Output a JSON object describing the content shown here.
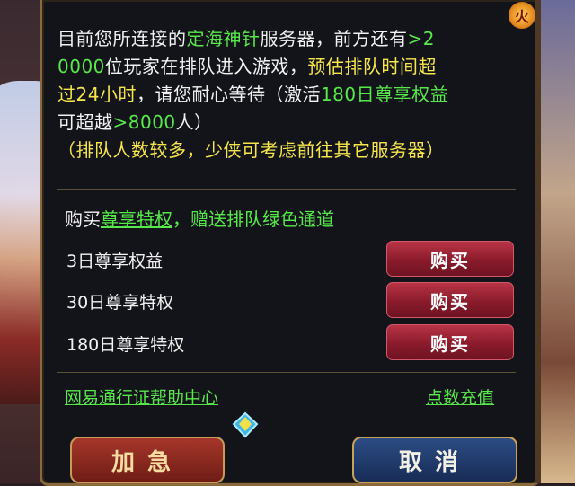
{
  "corner_icon": {
    "glyph": "火",
    "name": "fire-badge-icon"
  },
  "queue_message": {
    "line1_a": "目前您所连接的",
    "server_name": "定海神针",
    "line1_b": "服务器，前方还有",
    "ahead_count_a": ">2",
    "ahead_count_b": "0000",
    "line2_a": "位玩家在排队进入游戏，",
    "estimate_a": "预估排队时间超",
    "estimate_b": "过24小时",
    "line3_a": "，请您耐心等待（激活",
    "vip_days": "180日尊享权益",
    "line4_a": "可超越",
    "skip_count": ">8000",
    "line4_b": "人）",
    "hint": "（排队人数较多，少侠可考虑前往其它服务器）"
  },
  "purchase": {
    "title_a": "购买",
    "title_link": "尊享特权",
    "title_b": "，赠送排队绿色通道",
    "items": [
      {
        "label": "3日尊享权益",
        "button": "购买"
      },
      {
        "label": "30日尊享特权",
        "button": "购买"
      },
      {
        "label": "180日尊享特权",
        "button": "购买"
      }
    ]
  },
  "links": {
    "help_center": "网易通行证帮助中心",
    "recharge": "点数充值"
  },
  "actions": {
    "accelerate": "加急",
    "cancel": "取消"
  },
  "colors": {
    "highlight_green": "#57e84b",
    "highlight_yellow": "#f6e64b",
    "buy_button": "#a0283a",
    "accelerate_button": "#8a2a20",
    "cancel_button": "#22407a"
  }
}
